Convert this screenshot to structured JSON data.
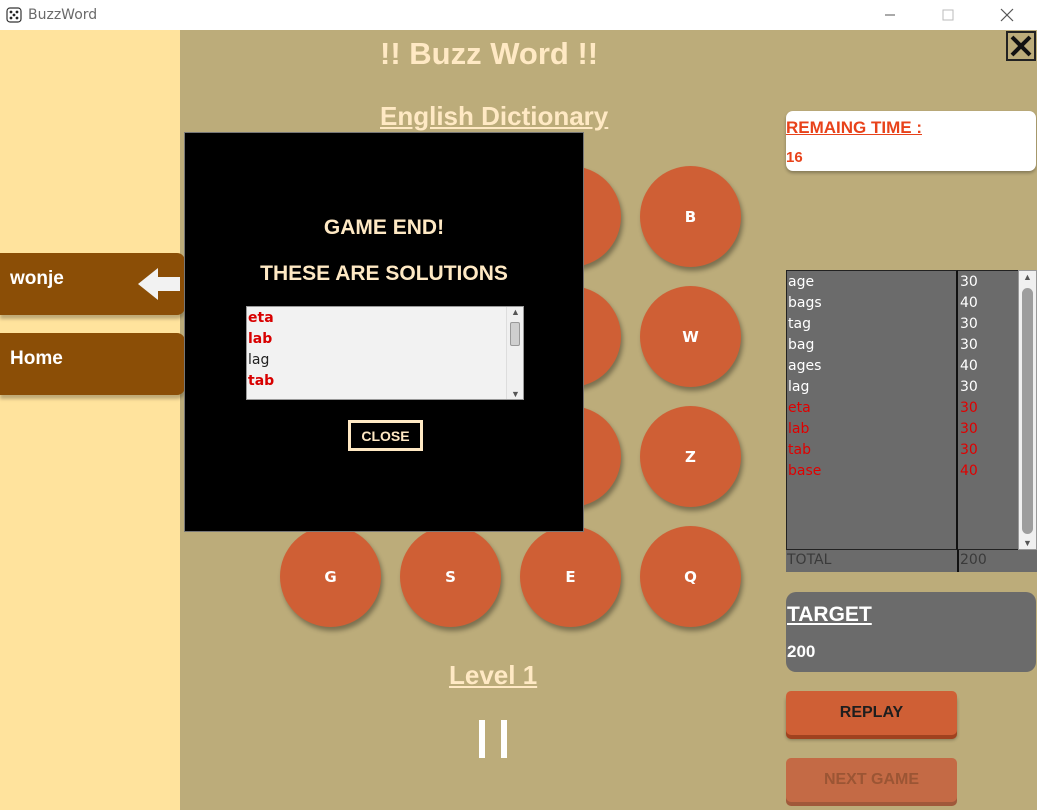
{
  "window": {
    "title": "BuzzWord",
    "icon": "dice-icon"
  },
  "sidebar": {
    "user_label": "wonje",
    "home_label": "Home"
  },
  "main": {
    "title": "!! Buzz Word !!",
    "dictionary": "English Dictionary",
    "level": "Level 1",
    "tiles": [
      "B",
      "W",
      "Z",
      "G",
      "S",
      "E",
      "Q"
    ]
  },
  "timer": {
    "label": "REMAING TIME :",
    "value": "16"
  },
  "scores": {
    "words": [
      {
        "word": "age",
        "points": "30",
        "highlight": false
      },
      {
        "word": "bags",
        "points": "40",
        "highlight": false
      },
      {
        "word": "tag",
        "points": "30",
        "highlight": false
      },
      {
        "word": "bag",
        "points": "30",
        "highlight": false
      },
      {
        "word": "ages",
        "points": "40",
        "highlight": false
      },
      {
        "word": "lag",
        "points": "30",
        "highlight": false
      },
      {
        "word": "eta",
        "points": "30",
        "highlight": true
      },
      {
        "word": "lab",
        "points": "30",
        "highlight": true
      },
      {
        "word": "tab",
        "points": "30",
        "highlight": true
      },
      {
        "word": "base",
        "points": "40",
        "highlight": true
      }
    ],
    "total_label": "TOTAL",
    "total_value": "200"
  },
  "target": {
    "label": "TARGET",
    "value": "200"
  },
  "buttons": {
    "replay": "REPLAY",
    "next_game": "NEXT GAME"
  },
  "modal": {
    "title": "GAME END!",
    "subtitle": "THESE ARE SOLUTIONS",
    "solutions": [
      {
        "word": "eta",
        "highlight": true
      },
      {
        "word": "lab",
        "highlight": true
      },
      {
        "word": "lag",
        "highlight": false
      },
      {
        "word": "tab",
        "highlight": true
      }
    ],
    "close_label": "CLOSE"
  },
  "colors": {
    "background": "#bcac7a",
    "sidebar": "#ffe39d",
    "side_button": "#8b4e06",
    "tile": "#cf5f35",
    "highlight_red": "#e00000",
    "timer_text": "#e8421a",
    "panel_gray": "#6b6b6b"
  }
}
